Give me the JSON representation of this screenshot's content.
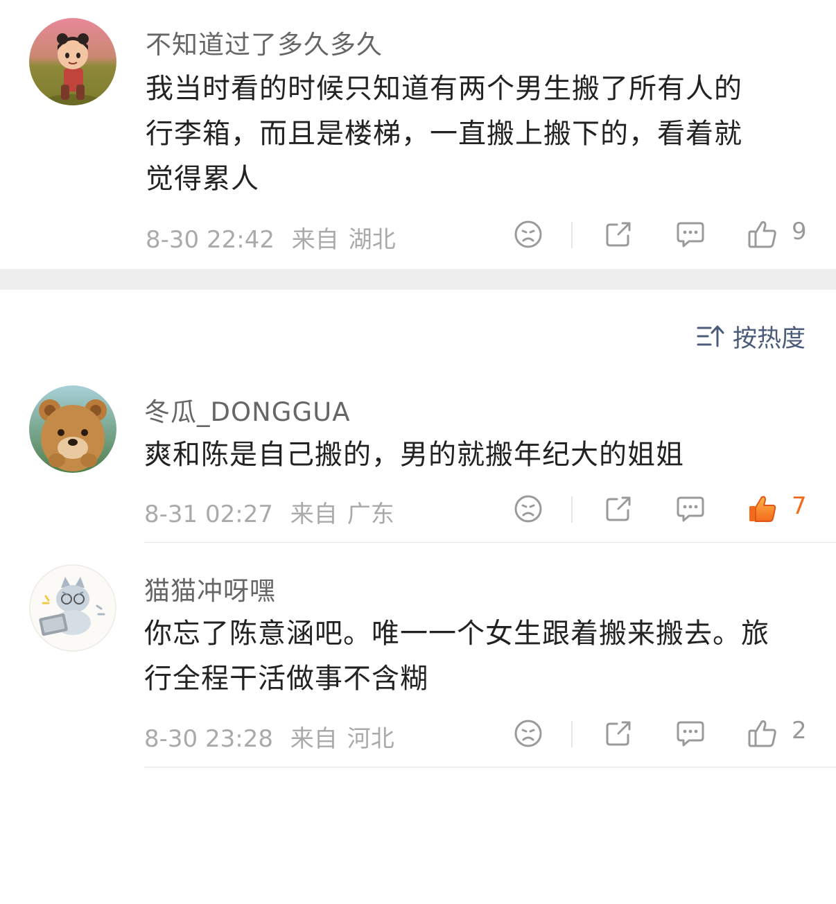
{
  "comments_top": {
    "username": "不知道过了多久多久",
    "text": "我当时看的时候只知道有两个男生搬了所有人的行李箱，而且是楼梯，一直搬上搬下的，看着就觉得累人",
    "time": "8-30 22:42",
    "from_label": "来自",
    "location": "湖北",
    "like_count": "9",
    "avatar_icon": "cartoon-character-avatar"
  },
  "sort": {
    "label": "按热度",
    "icon": "sort-icon"
  },
  "comments": [
    {
      "username": "冬瓜_DONGGUA",
      "text": "爽和陈是自己搬的，男的就搬年纪大的姐姐",
      "time": "8-31 02:27",
      "from_label": "来自",
      "location": "广东",
      "like_count": "7",
      "liked": true,
      "avatar_icon": "bear-avatar"
    },
    {
      "username": "猫猫冲呀嘿",
      "text": "你忘了陈意涵吧。唯一一个女生跟着搬来搬去。旅行全程干活做事不含糊",
      "time": "8-30 23:28",
      "from_label": "来自",
      "location": "河北",
      "like_count": "2",
      "liked": false,
      "avatar_icon": "cat-avatar"
    }
  ],
  "colors": {
    "liked": "#f26a1b",
    "icon": "#9a9a9a",
    "sort": "#4a5c7a"
  }
}
